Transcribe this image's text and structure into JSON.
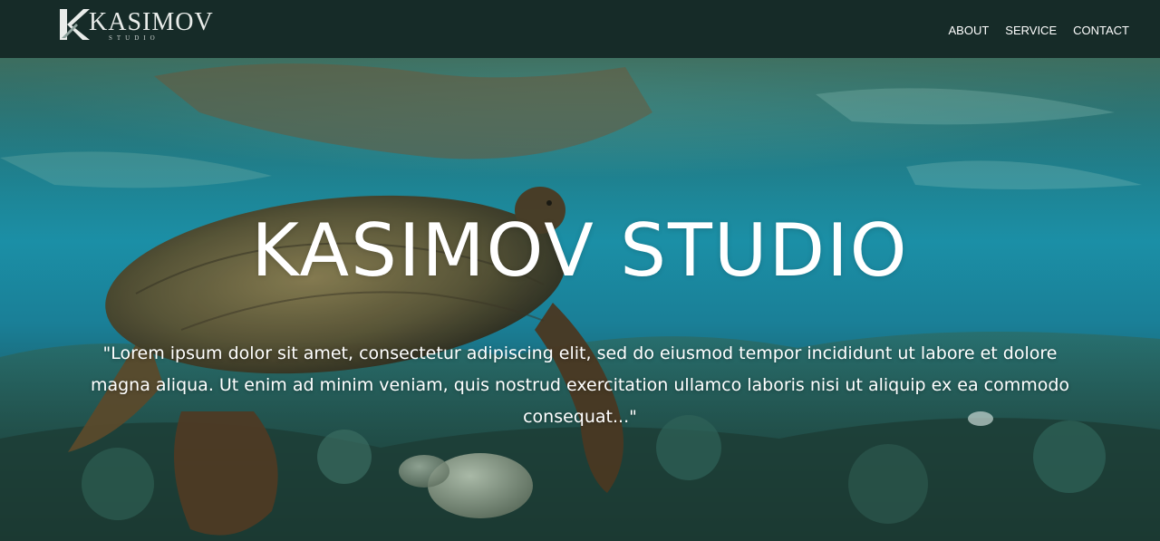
{
  "header": {
    "logo_text": "KASIMOV",
    "logo_sub": "STUDIO",
    "nav": [
      {
        "label": "ABOUT"
      },
      {
        "label": "SERVICE"
      },
      {
        "label": "CONTACT"
      }
    ]
  },
  "hero": {
    "title": "KASIMOV STUDIO",
    "quote": "\"Lorem ipsum dolor sit amet, consectetur adipiscing elit, sed do eiusmod tempor incididunt ut labore et dolore magna aliqua. Ut enim ad minim veniam, quis nostrud exercitation ullamco laboris nisi ut aliquip ex ea commodo consequat...\"",
    "background_image": "sea-turtle-underwater-photo"
  },
  "colors": {
    "header_bg": "#162b28",
    "nav_text": "#ffffff",
    "water": "#1b8fa6"
  }
}
